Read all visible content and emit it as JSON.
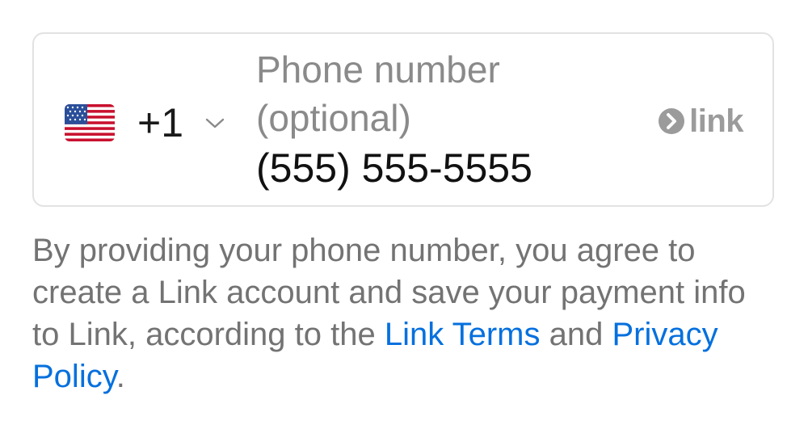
{
  "phone_field": {
    "country_flag": "us-flag-icon",
    "dial_code": "+1",
    "label": "Phone number (optional)",
    "placeholder": "(555) 555-5555",
    "value": ""
  },
  "link_badge": {
    "icon": "chevron-right-circle-icon",
    "label": "link"
  },
  "disclaimer": {
    "text_before": "By providing your phone number, you agree to create a Link account and save your payment info to Link, according to the ",
    "terms_link": "Link Terms",
    "text_middle": " and ",
    "privacy_link": "Privacy Policy",
    "text_after": "."
  },
  "colors": {
    "link_blue": "#0570de",
    "muted_text": "#737373",
    "label_gray": "#8a8a8a",
    "border": "#e2e2e2"
  }
}
